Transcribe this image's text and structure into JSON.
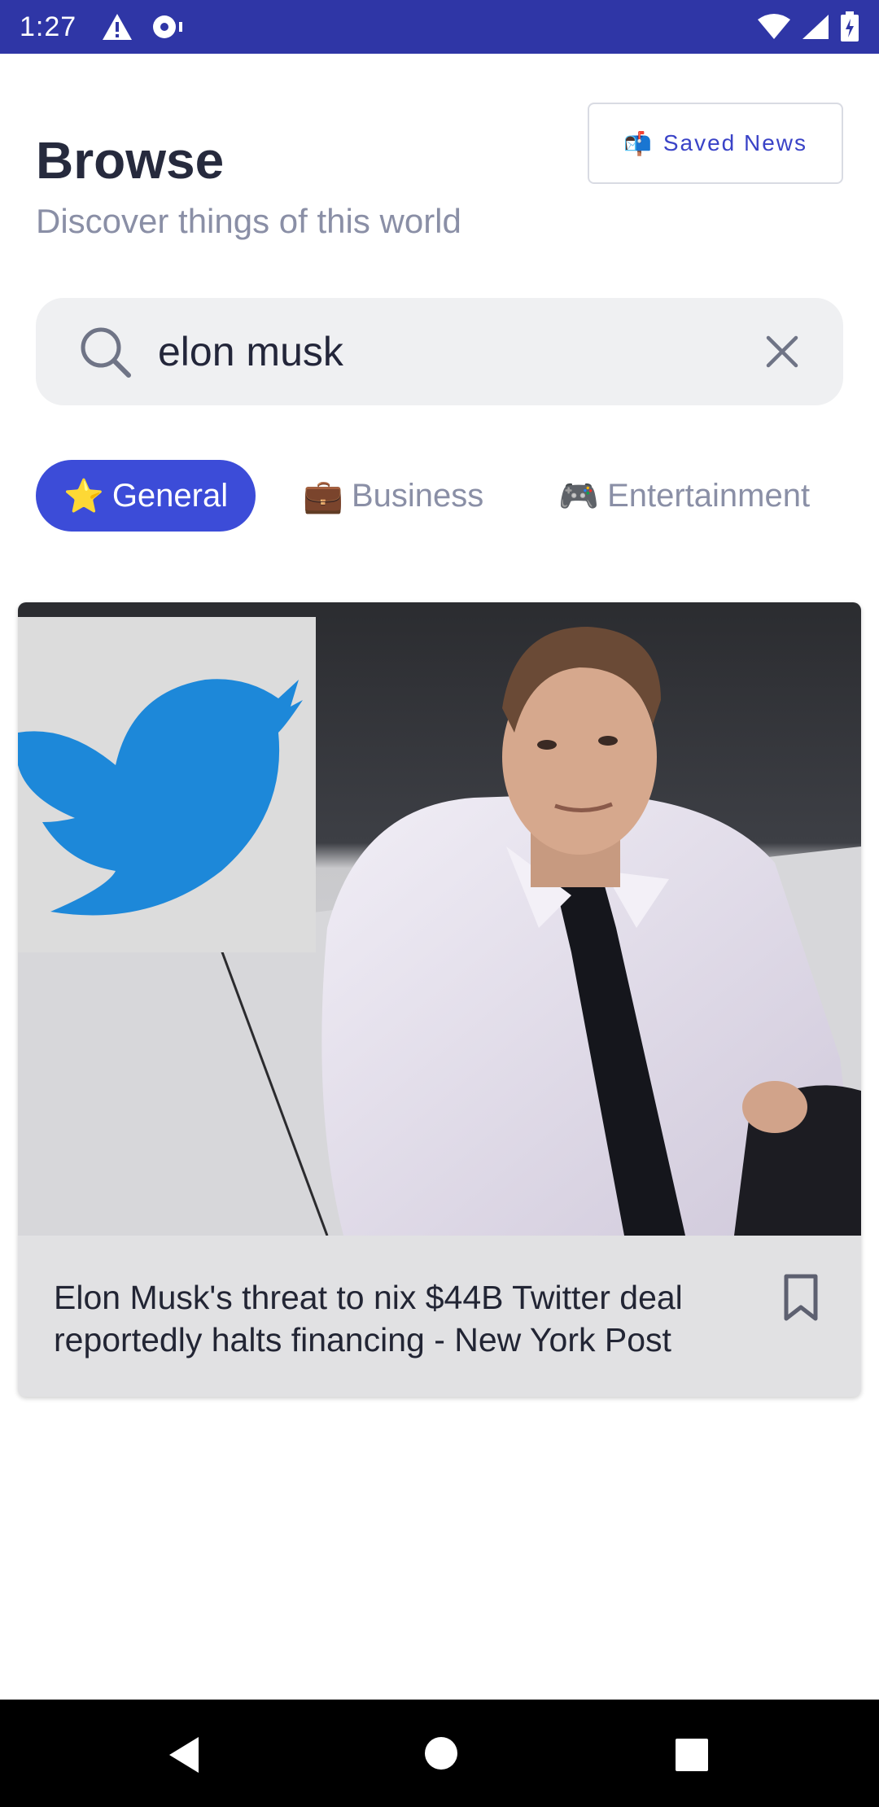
{
  "status_bar": {
    "time": "1:27",
    "icons": [
      "alert-icon",
      "vpn-icon",
      "wifi-icon",
      "signal-icon",
      "battery-icon"
    ]
  },
  "header": {
    "title": "Browse",
    "subtitle": "Discover things of this world",
    "saved_button": {
      "emoji": "📬",
      "label": "Saved News"
    }
  },
  "search": {
    "value": "elon musk",
    "icon": "search-icon",
    "clear_icon": "close-icon"
  },
  "categories": [
    {
      "emoji": "⭐",
      "label": "General",
      "active": true
    },
    {
      "emoji": "💼",
      "label": "Business",
      "active": false
    },
    {
      "emoji": "🎮",
      "label": "Entertainment",
      "active": false
    }
  ],
  "articles": [
    {
      "title": "Elon Musk's threat to nix $44B Twitter deal reportedly halts financing - New York Post",
      "bookmark_icon": "bookmark-icon"
    }
  ],
  "colors": {
    "status_bar": "#2f36a6",
    "accent": "#3c4cd8",
    "twitter_blue": "#1d88d9"
  },
  "nav_bar": {
    "icons": [
      "back-icon",
      "home-icon",
      "recents-icon"
    ]
  }
}
